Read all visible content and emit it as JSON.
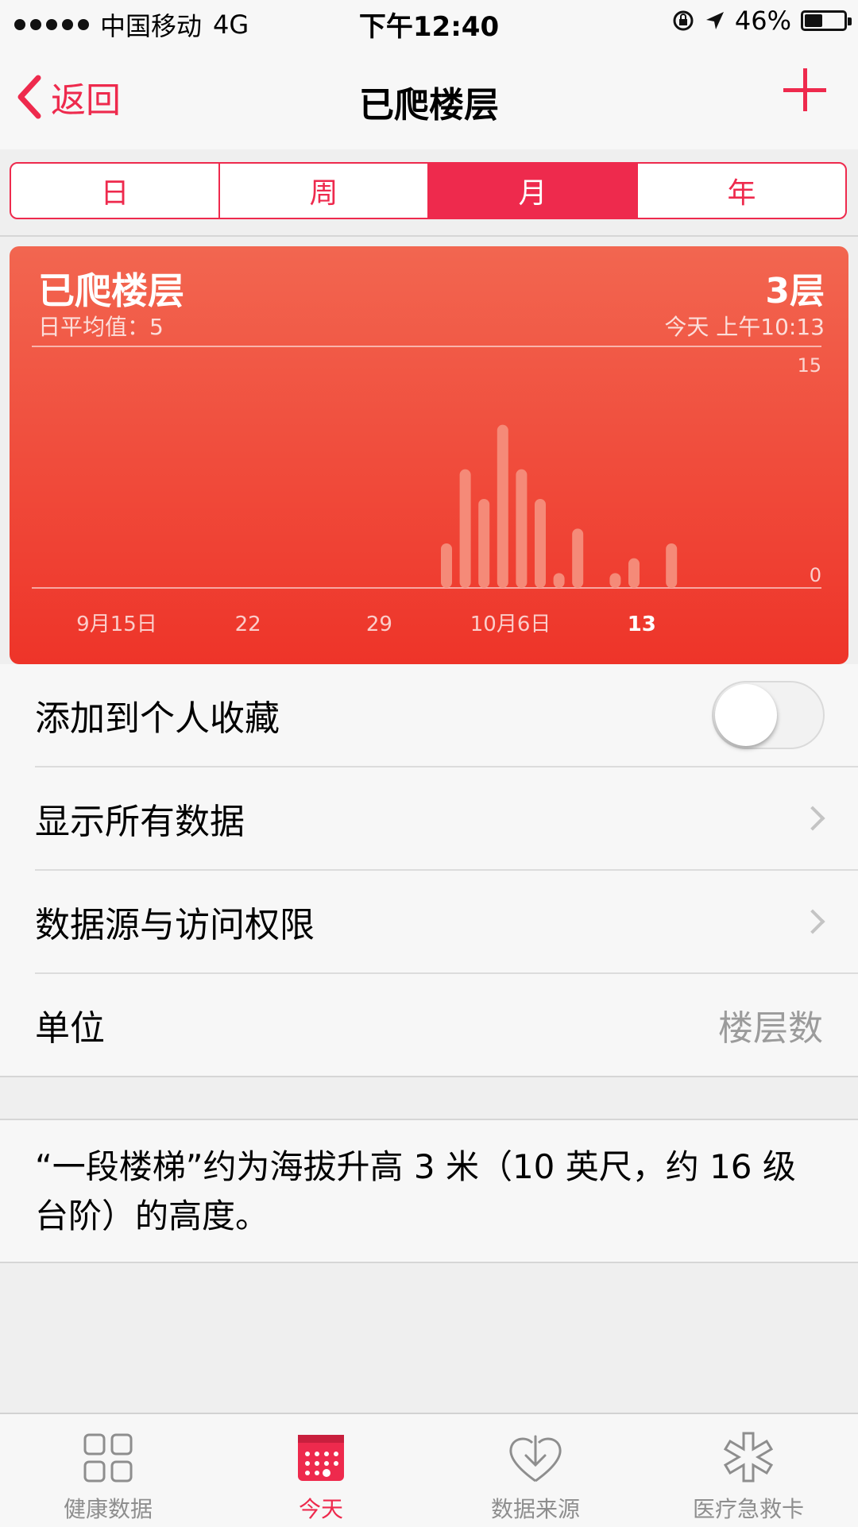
{
  "status": {
    "carrier": "中国移动",
    "network": "4G",
    "time": "下午12:40",
    "battery": "46%",
    "battery_level": 0.46
  },
  "nav": {
    "back_label": "返回",
    "title": "已爬楼层"
  },
  "segments": [
    "日",
    "周",
    "月",
    "年"
  ],
  "selected_segment": "月",
  "card": {
    "title": "已爬楼层",
    "subtitle": "日平均值：5",
    "value": "3层",
    "timestamp": "今天 上午10:13",
    "chart_data": {
      "type": "bar",
      "x_ticks": [
        "9月15日",
        "22",
        "29",
        "10月6日",
        "13"
      ],
      "ylim": [
        0,
        15
      ],
      "y_ticks": [
        "15",
        "0"
      ],
      "x_start_day": "2015-09-15",
      "values": [
        0,
        0,
        0,
        0,
        0,
        0,
        0,
        0,
        0,
        0,
        0,
        0,
        0,
        0,
        0,
        0,
        0,
        0,
        0,
        0,
        3,
        8,
        6,
        11,
        8,
        6,
        1,
        4,
        0,
        1,
        2,
        0,
        3
      ],
      "grid": false,
      "colors": {
        "bar": "#f58a78",
        "bg_top": "#f26650",
        "bg_bottom": "#ee3429"
      }
    }
  },
  "list": {
    "favorite_label": "添加到个人收藏",
    "show_all_label": "显示所有数据",
    "sources_label": "数据源与访问权限",
    "unit_label": "单位",
    "unit_value": "楼层数"
  },
  "note": "“一段楼梯”约为海拔升高 3 米（10 英尺，约 16 级台阶）的高度。",
  "tabs": [
    {
      "label": "健康数据",
      "icon": "grid-icon"
    },
    {
      "label": "今天",
      "icon": "calendar-icon"
    },
    {
      "label": "数据来源",
      "icon": "download-heart-icon"
    },
    {
      "label": "医疗急救卡",
      "icon": "medical-star-icon"
    }
  ],
  "accent": "#ee2a4d"
}
